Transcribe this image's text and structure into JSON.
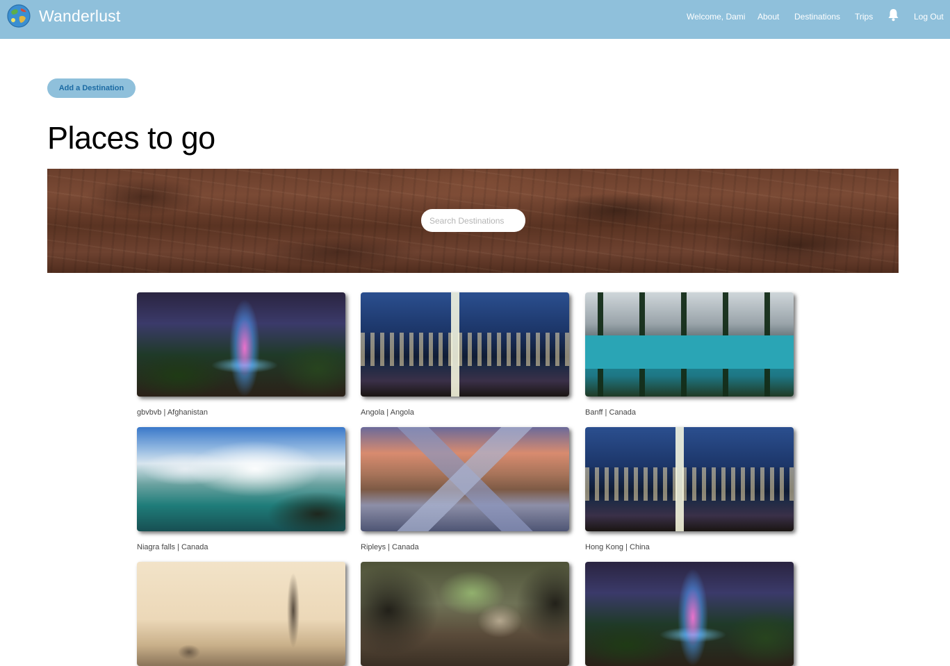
{
  "nav": {
    "brand": "Wanderlust",
    "links": {
      "welcome": "Welcome, Dami",
      "about": "About",
      "destinations": "Destinations",
      "trips": "Trips",
      "logout": "Log Out"
    },
    "icons": {
      "logo": "globe-logo-icon",
      "notifications": "bell-icon"
    },
    "color": "#8fc0db"
  },
  "actions": {
    "add_destination": "Add a Destination"
  },
  "page": {
    "title": "Places to go"
  },
  "search": {
    "placeholder": "Search Destinations",
    "value": ""
  },
  "destinations": [
    {
      "caption": "gbvbvb | Afghanistan"
    },
    {
      "caption": "Angola | Angola"
    },
    {
      "caption": "Banff | Canada"
    },
    {
      "caption": "Niagra falls | Canada"
    },
    {
      "caption": "Ripleys | Canada"
    },
    {
      "caption": "Hong Kong | China"
    },
    {
      "caption": ""
    },
    {
      "caption": ""
    },
    {
      "caption": ""
    }
  ],
  "colors": {
    "accent": "#8fc0db",
    "button_text": "#1b6aa3"
  }
}
